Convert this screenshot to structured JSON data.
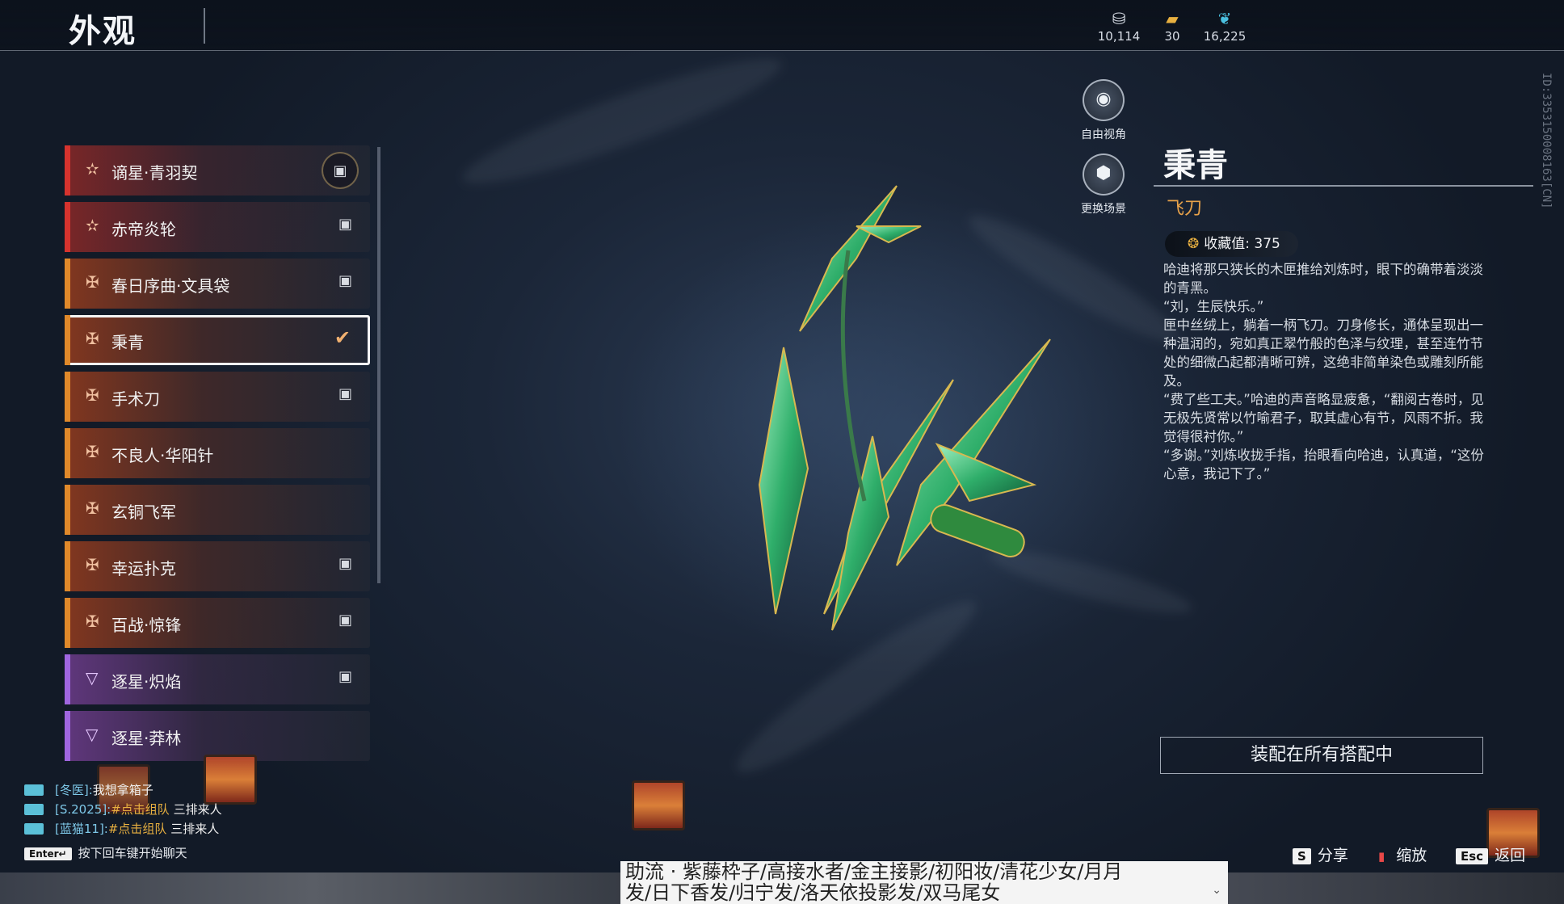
{
  "header": {
    "title": "外观"
  },
  "currencies": [
    {
      "icon": "coin-stack-icon",
      "glyph": "⛁",
      "value": "10,114"
    },
    {
      "icon": "ticket-icon",
      "glyph": "▰",
      "value": "30"
    },
    {
      "icon": "feather-icon",
      "glyph": "❦",
      "value": "16,225"
    }
  ],
  "side_id": "ID:3353150008163[CN]",
  "items": [
    {
      "label": "谪星·青羽契",
      "rarity": "red",
      "glyph": "✫",
      "state": "lock-ring"
    },
    {
      "label": "赤帝炎轮",
      "rarity": "red",
      "glyph": "✫",
      "state": "lock"
    },
    {
      "label": "春日序曲·文具袋",
      "rarity": "orange",
      "glyph": "✠",
      "state": "lock"
    },
    {
      "label": "秉青",
      "rarity": "orange",
      "glyph": "✠",
      "state": "selected"
    },
    {
      "label": "手术刀",
      "rarity": "orange",
      "glyph": "✠",
      "state": "lock"
    },
    {
      "label": "不良人·华阳针",
      "rarity": "orange",
      "glyph": "✠",
      "state": "none"
    },
    {
      "label": "玄铜飞军",
      "rarity": "orange",
      "glyph": "✠",
      "state": "none"
    },
    {
      "label": "幸运扑克",
      "rarity": "orange",
      "glyph": "✠",
      "state": "lock"
    },
    {
      "label": "百战·惊锋",
      "rarity": "orange",
      "glyph": "✠",
      "state": "lock"
    },
    {
      "label": "逐星·炽焰",
      "rarity": "purple",
      "glyph": "▽",
      "state": "lock"
    },
    {
      "label": "逐星·莽林",
      "rarity": "purple",
      "glyph": "▽",
      "state": "none"
    }
  ],
  "tools": {
    "free_view": {
      "label": "自由视角",
      "icon": "camera-icon"
    },
    "scene": {
      "label": "更换场景",
      "icon": "cube-icon"
    }
  },
  "detail": {
    "name": "秉青",
    "type": "飞刀",
    "collect_label": "收藏值:",
    "collect_value": "375",
    "desc": [
      "哈迪将那只狭长的木匣推给刘炼时，眼下的确带着淡淡的青黑。",
      "“刘，生辰快乐。”",
      "匣中丝绒上，躺着一柄飞刀。刀身修长，通体呈现出一种温润的，宛如真正翠竹般的色泽与纹理，甚至连竹节处的细微凸起都清晰可辨，这绝非简单染色或雕刻所能及。",
      "“费了些工夫。”哈迪的声音略显疲惫，“翻阅古卷时，见无极先贤常以竹喻君子，取其虚心有节，风雨不折。我觉得很衬你。”",
      "“多谢。”刘炼收拢手指，抬眼看向哈迪，认真道，“这份心意，我记下了。”"
    ],
    "equip_label": "装配在所有搭配中"
  },
  "chat": [
    {
      "who": "[冬医]:",
      "link": "",
      "text": "我想拿箱子"
    },
    {
      "who": "[S.2025]:",
      "link": "#点击组队",
      "text": " 三排来人"
    },
    {
      "who": "[蓝猫11]:",
      "link": "#点击组队",
      "text": " 三排来人"
    }
  ],
  "enter_hint": {
    "key": "Enter↵",
    "text": "按下回车键开始聊天"
  },
  "hints": [
    {
      "key": "S",
      "label": "分享"
    },
    {
      "key": "▮",
      "label": "缩放"
    },
    {
      "key": "Esc",
      "label": "返回"
    }
  ],
  "notice": {
    "line1": "助流 · 紫藤枠子/高接水者/金主接影/初阳妆/清花少女/月月",
    "line2": "发/日下香发/归宁发/洛天依投影发/双马尾女"
  }
}
